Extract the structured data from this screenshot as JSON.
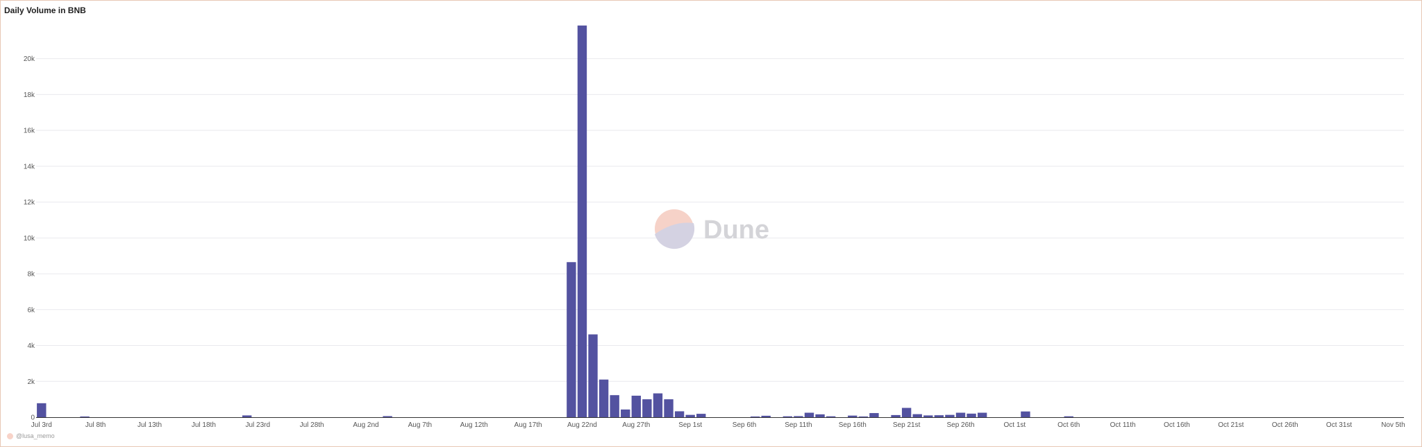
{
  "panel": {
    "title": "Daily Volume in BNB",
    "attribution": "@lusa_memo"
  },
  "watermark": {
    "text": "Dune"
  },
  "colors": {
    "bar": "#5352a0",
    "grid": "#e9e9ee",
    "frame": "#e8c8b4"
  },
  "chart_data": {
    "type": "bar",
    "title": "Daily Volume in BNB",
    "xlabel": "",
    "ylabel": "",
    "ylim": [
      0,
      22500
    ],
    "y_ticks": [
      0,
      2000,
      4000,
      6000,
      8000,
      10000,
      12000,
      14000,
      16000,
      18000,
      20000
    ],
    "y_tick_labels": [
      "0",
      "2k",
      "4k",
      "6k",
      "8k",
      "10k",
      "12k",
      "14k",
      "16k",
      "18k",
      "20k"
    ],
    "x_range": [
      "2023-07-03",
      "2023-11-06"
    ],
    "x_ticks": [
      {
        "date": "2023-07-03",
        "label": "Jul 3rd"
      },
      {
        "date": "2023-07-08",
        "label": "Jul 8th"
      },
      {
        "date": "2023-07-13",
        "label": "Jul 13th"
      },
      {
        "date": "2023-07-18",
        "label": "Jul 18th"
      },
      {
        "date": "2023-07-23",
        "label": "Jul 23rd"
      },
      {
        "date": "2023-07-28",
        "label": "Jul 28th"
      },
      {
        "date": "2023-08-02",
        "label": "Aug 2nd"
      },
      {
        "date": "2023-08-07",
        "label": "Aug 7th"
      },
      {
        "date": "2023-08-12",
        "label": "Aug 12th"
      },
      {
        "date": "2023-08-17",
        "label": "Aug 17th"
      },
      {
        "date": "2023-08-22",
        "label": "Aug 22nd"
      },
      {
        "date": "2023-08-27",
        "label": "Aug 27th"
      },
      {
        "date": "2023-09-01",
        "label": "Sep 1st"
      },
      {
        "date": "2023-09-06",
        "label": "Sep 6th"
      },
      {
        "date": "2023-09-11",
        "label": "Sep 11th"
      },
      {
        "date": "2023-09-16",
        "label": "Sep 16th"
      },
      {
        "date": "2023-09-21",
        "label": "Sep 21st"
      },
      {
        "date": "2023-09-26",
        "label": "Sep 26th"
      },
      {
        "date": "2023-10-01",
        "label": "Oct 1st"
      },
      {
        "date": "2023-10-06",
        "label": "Oct 6th"
      },
      {
        "date": "2023-10-11",
        "label": "Oct 11th"
      },
      {
        "date": "2023-10-16",
        "label": "Oct 16th"
      },
      {
        "date": "2023-10-21",
        "label": "Oct 21st"
      },
      {
        "date": "2023-10-26",
        "label": "Oct 26th"
      },
      {
        "date": "2023-10-31",
        "label": "Oct 31st"
      },
      {
        "date": "2023-11-05",
        "label": "Nov 5th"
      }
    ],
    "grid": true,
    "legend": "none",
    "series": [
      {
        "values": [
          {
            "x": "2023-07-03",
            "y": 780
          },
          {
            "x": "2023-07-07",
            "y": 40
          },
          {
            "x": "2023-07-22",
            "y": 100
          },
          {
            "x": "2023-08-04",
            "y": 60
          },
          {
            "x": "2023-08-21",
            "y": 8650
          },
          {
            "x": "2023-08-22",
            "y": 21850
          },
          {
            "x": "2023-08-23",
            "y": 4620
          },
          {
            "x": "2023-08-24",
            "y": 2100
          },
          {
            "x": "2023-08-25",
            "y": 1230
          },
          {
            "x": "2023-08-26",
            "y": 430
          },
          {
            "x": "2023-08-27",
            "y": 1200
          },
          {
            "x": "2023-08-28",
            "y": 1000
          },
          {
            "x": "2023-08-29",
            "y": 1330
          },
          {
            "x": "2023-08-30",
            "y": 1000
          },
          {
            "x": "2023-08-31",
            "y": 330
          },
          {
            "x": "2023-09-01",
            "y": 130
          },
          {
            "x": "2023-09-02",
            "y": 190
          },
          {
            "x": "2023-09-07",
            "y": 40
          },
          {
            "x": "2023-09-08",
            "y": 80
          },
          {
            "x": "2023-09-10",
            "y": 50
          },
          {
            "x": "2023-09-11",
            "y": 60
          },
          {
            "x": "2023-09-12",
            "y": 250
          },
          {
            "x": "2023-09-13",
            "y": 160
          },
          {
            "x": "2023-09-14",
            "y": 50
          },
          {
            "x": "2023-09-16",
            "y": 90
          },
          {
            "x": "2023-09-17",
            "y": 40
          },
          {
            "x": "2023-09-18",
            "y": 230
          },
          {
            "x": "2023-09-20",
            "y": 120
          },
          {
            "x": "2023-09-21",
            "y": 520
          },
          {
            "x": "2023-09-22",
            "y": 170
          },
          {
            "x": "2023-09-23",
            "y": 100
          },
          {
            "x": "2023-09-24",
            "y": 110
          },
          {
            "x": "2023-09-25",
            "y": 130
          },
          {
            "x": "2023-09-26",
            "y": 250
          },
          {
            "x": "2023-09-27",
            "y": 200
          },
          {
            "x": "2023-09-28",
            "y": 250
          },
          {
            "x": "2023-10-02",
            "y": 320
          },
          {
            "x": "2023-10-06",
            "y": 50
          }
        ]
      }
    ]
  }
}
